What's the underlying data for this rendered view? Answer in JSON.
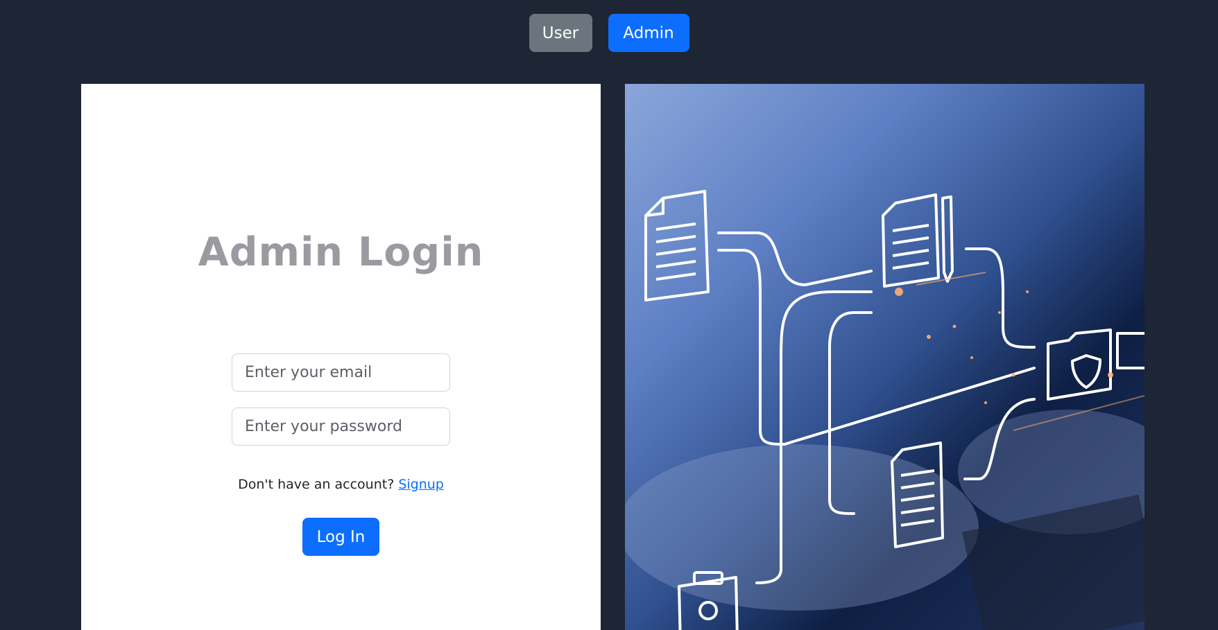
{
  "role_switch": {
    "user_label": "User",
    "admin_label": "Admin"
  },
  "login": {
    "title": "Admin Login",
    "email_placeholder": "Enter your email",
    "password_placeholder": "Enter your password",
    "signup_prompt": "Don't have an account?",
    "signup_link": "Signup",
    "submit_label": "Log In"
  },
  "colors": {
    "background": "#1e2534",
    "primary": "#0d6efd",
    "secondary": "#6c757d",
    "title": "#9a9aa0"
  },
  "illustration": {
    "icons": [
      "document-icon",
      "document-with-pen-icon",
      "folder-shield-icon",
      "clipboard-person-icon"
    ]
  }
}
